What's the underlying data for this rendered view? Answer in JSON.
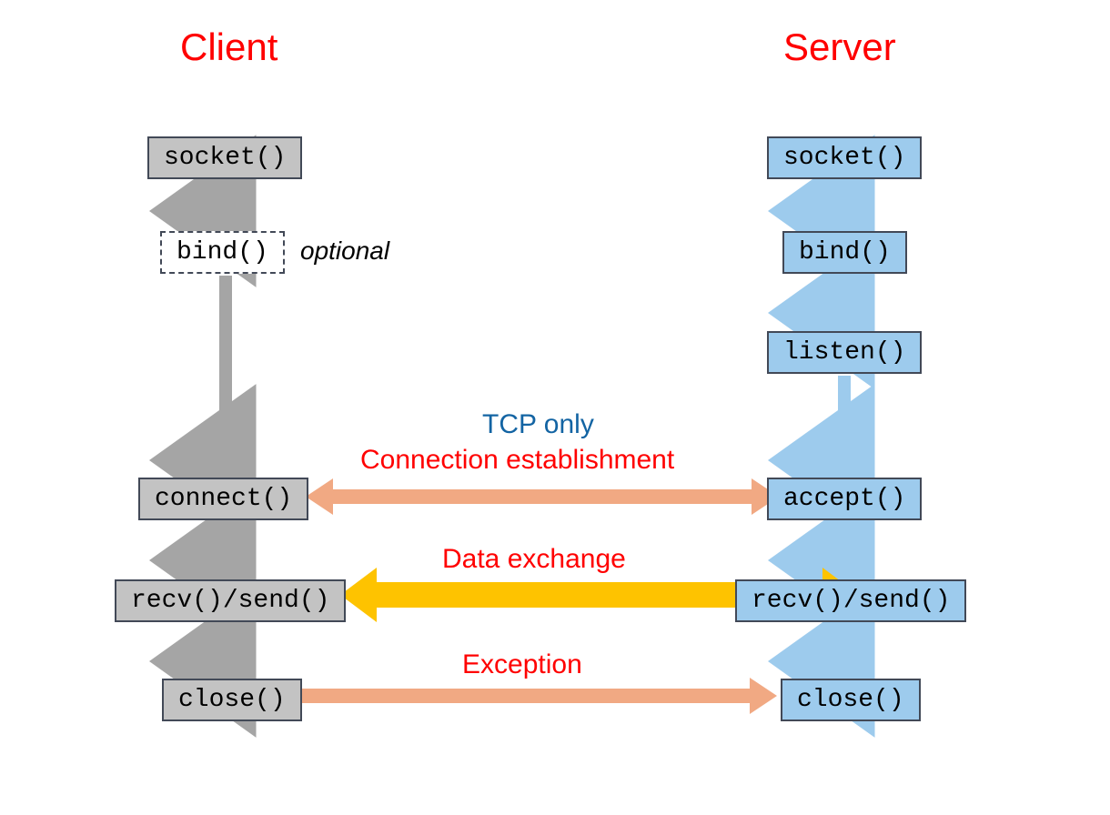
{
  "titles": {
    "client": "Client",
    "server": "Server"
  },
  "client": {
    "socket": "socket()",
    "bind": "bind()",
    "bind_note": "optional",
    "connect": "connect()",
    "recv_send": "recv()/send()",
    "close": "close()"
  },
  "server": {
    "socket": "socket()",
    "bind": "bind()",
    "listen": "listen()",
    "accept": "accept()",
    "recv_send": "recv()/send()",
    "close": "close()"
  },
  "labels": {
    "tcp_only": "TCP only",
    "conn_est": "Connection establishment",
    "data_exch": "Data exchange",
    "exception": "Exception"
  },
  "colors": {
    "title_red": "#ff0000",
    "client_fill": "#c3c3c3",
    "server_fill": "#9dcbed",
    "arrow_gray": "#a5a5a5",
    "arrow_blue": "#9dcbed",
    "arrow_orange": "#f1a983",
    "arrow_yellow": "#fec300",
    "label_blue": "#1364a3"
  }
}
